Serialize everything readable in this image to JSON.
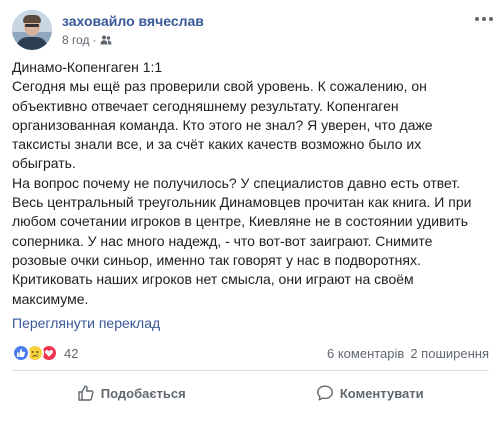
{
  "post": {
    "author": "заховайло вячеслав",
    "time": "8 год",
    "audience_icon": "friends-icon",
    "text_lines": [
      "Динамо-Копенгаген 1:1",
      "Сегодня мы ещё раз проверили свой уровень. К сожалению, он",
      "объективно отвечает сегодняшнему результату. Копенгаген",
      "организованная команда. Кто этого не знал? Я уверен, что даже",
      "таксисты знали все, и за счёт каких качеств возможно было их",
      "обыграть.",
      "На вопрос почему не получилось? У специалистов давно есть ответ.",
      "Весь центральный треугольник Динамовцев прочитан как книга. И при",
      "любом сочетании игроков в центре, Киевляне не в состоянии удивить",
      "соперника. У нас много надежд, - что вот-вот заиграют. Снимите",
      "розовые очки синьор, именно так говорят у нас в подворотнях.",
      "Критиковать наших игроков нет смысла, они играют на своём",
      "максимуме."
    ],
    "translate_link": "Переглянути переклад"
  },
  "reactions": {
    "icons": [
      "like-icon",
      "sad-icon",
      "love-icon"
    ],
    "count": "42",
    "comments": "6 коментарів",
    "shares": "2 поширення"
  },
  "actions": {
    "like": "Подобається",
    "comment": "Коментувати"
  },
  "colors": {
    "link": "#385898",
    "secondary": "#606770",
    "like": "#4a7ef0",
    "sad": "#f7d23e",
    "love": "#f0344f"
  }
}
